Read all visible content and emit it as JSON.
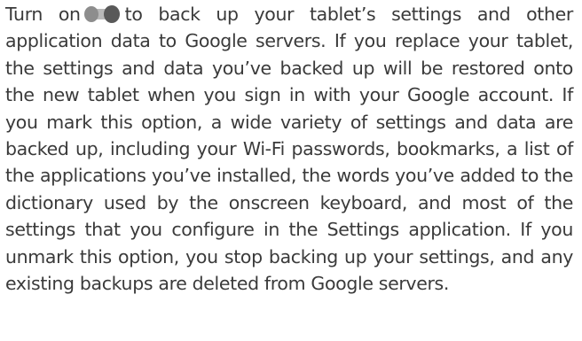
{
  "paragraph": {
    "lead": "Turn on",
    "body": "to back up your tablet’s settings and other application data to Google servers. If you replace your tablet, the settings and data you’ve backed up will be restored onto the new tablet when you sign in with your Google account. If you mark this option, a wide variety of settings and data are backed up, including your Wi-Fi passwords, bookmarks, a list of the applications you’ve installed, the words you’ve added to the dictionary used by the onscreen keyboard, and most of the settings that you configure in the Settings application. If you unmark this option, you stop backing up your settings, and any existing backups are deleted from Google servers.",
    "inline_icon": "toggle-switch-icon"
  },
  "colors": {
    "text": "#3a3a3a",
    "toggle_track": "#b8b8b8",
    "toggle_thumb": "#595959"
  }
}
